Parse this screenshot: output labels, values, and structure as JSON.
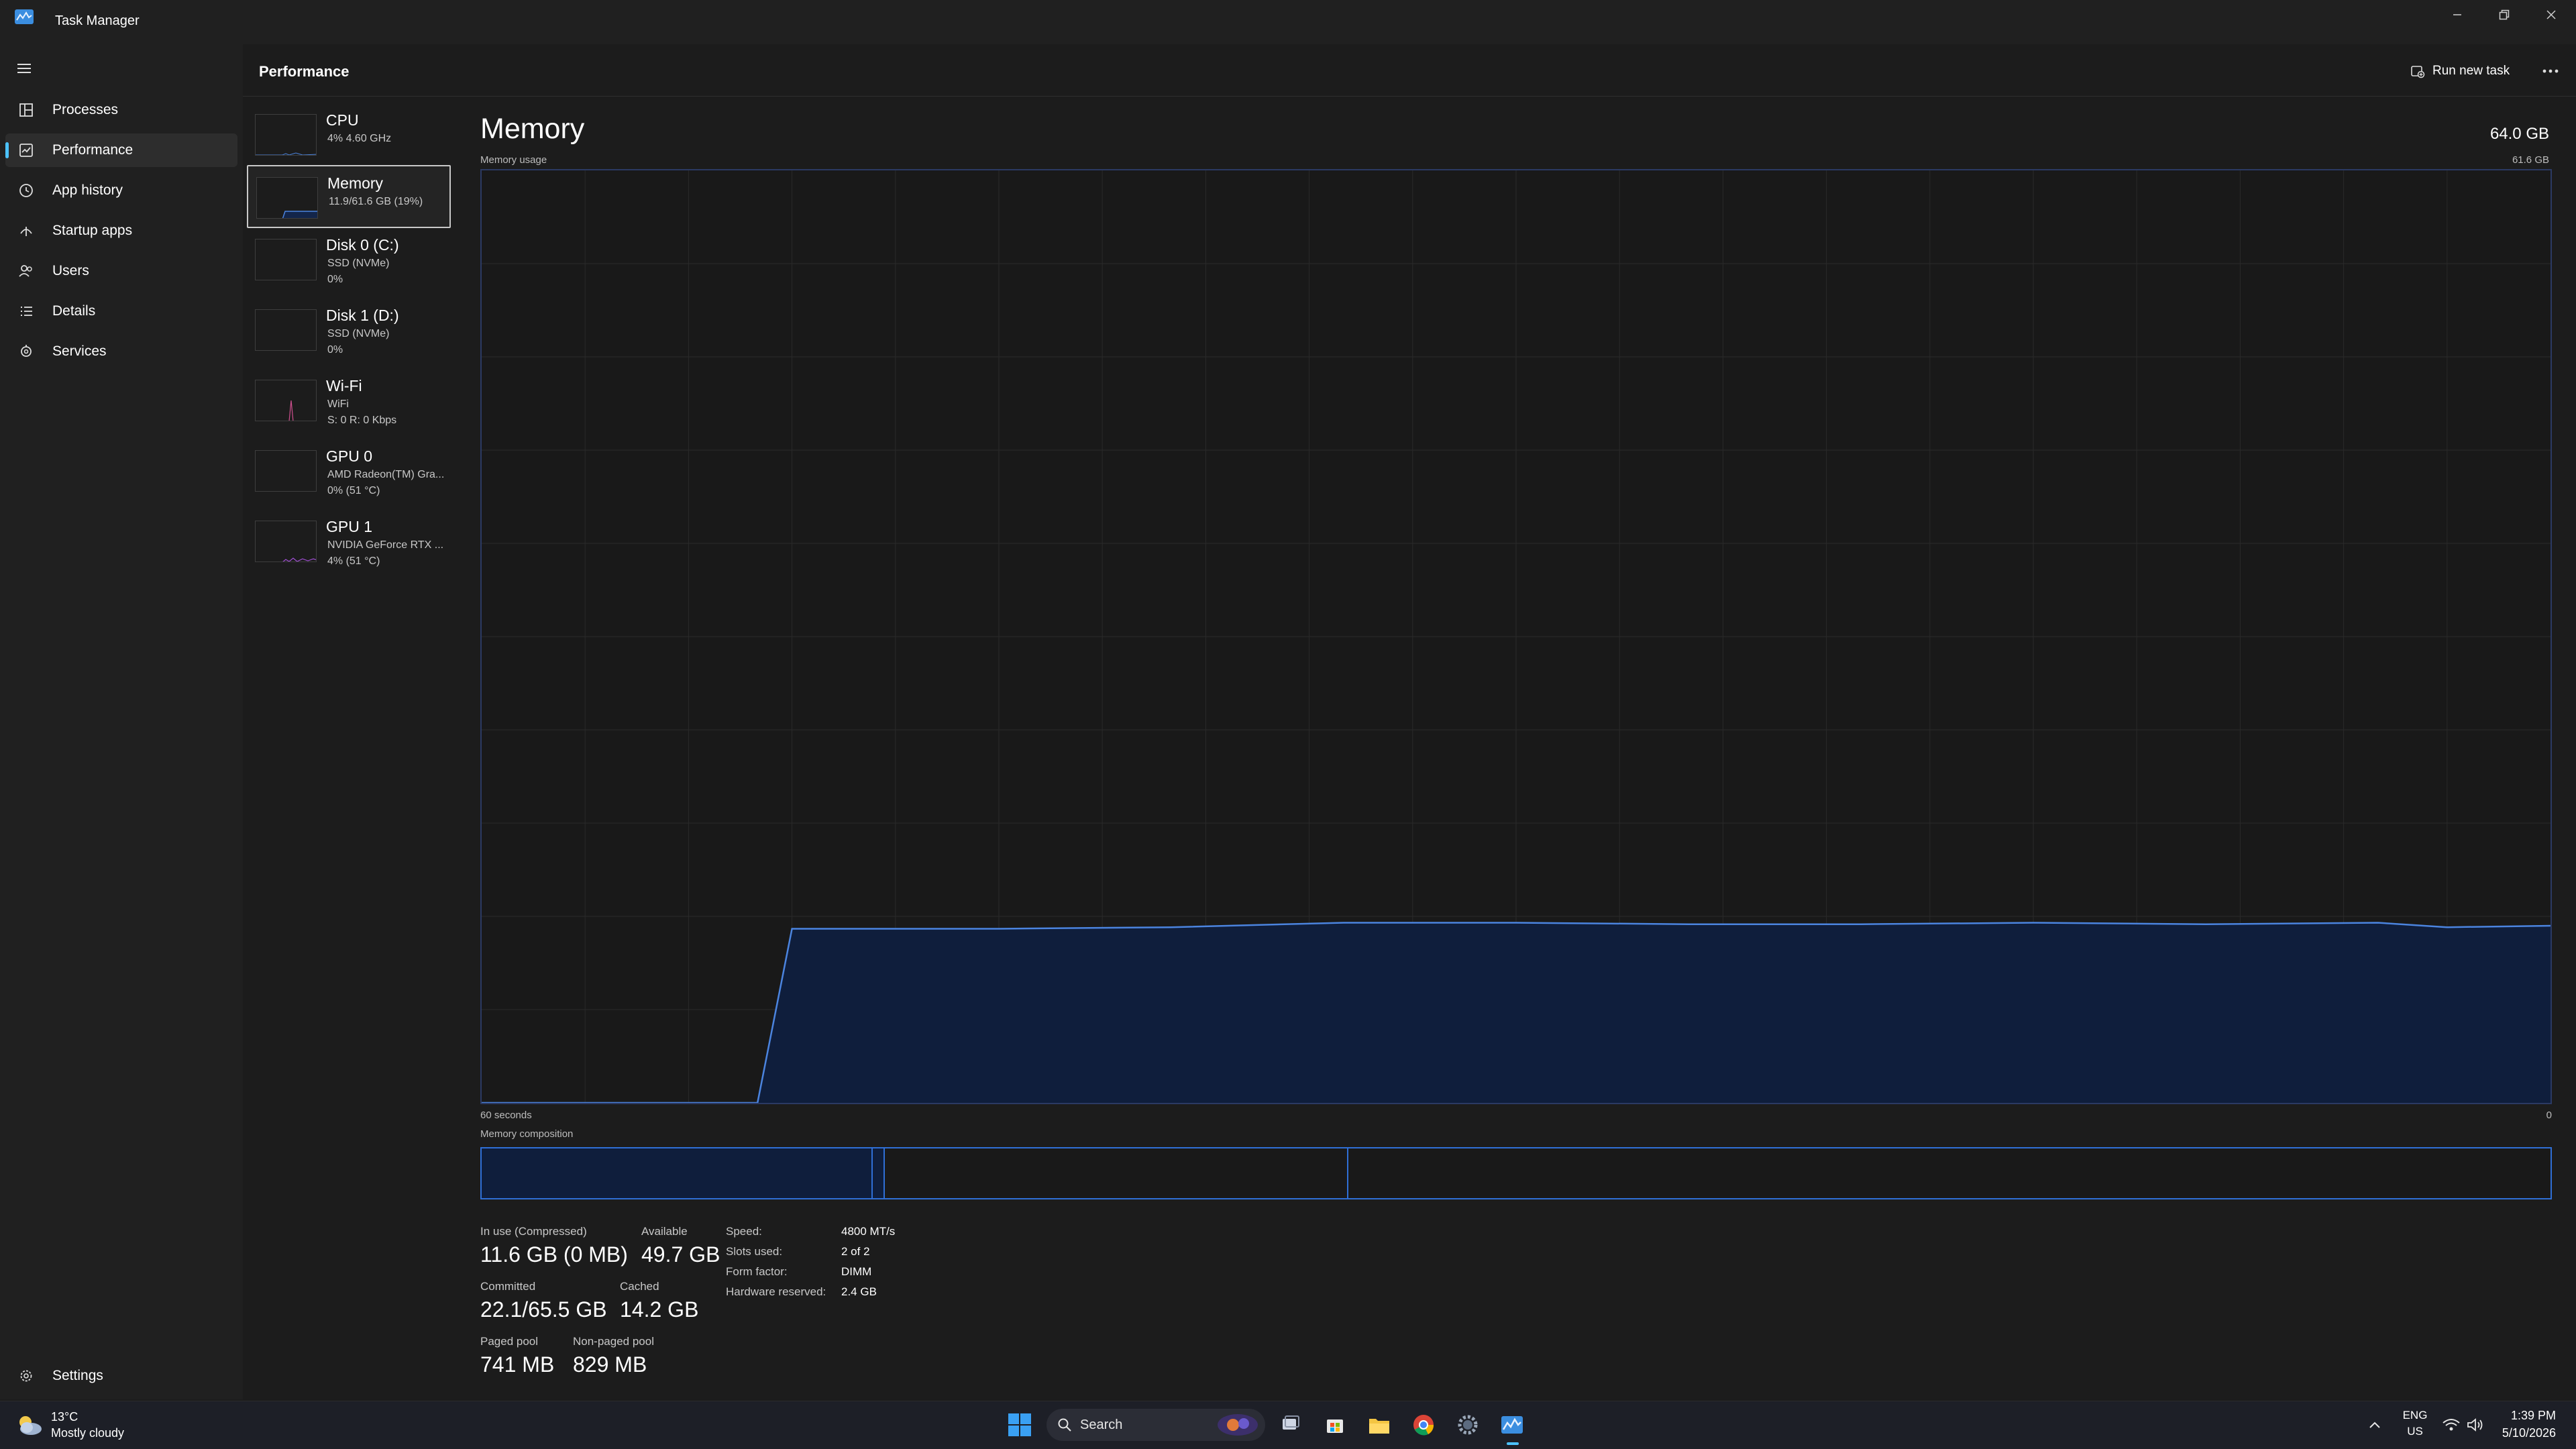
{
  "window": {
    "title": "Task Manager"
  },
  "nav": {
    "items": [
      {
        "label": "Processes",
        "icon": "processes-icon"
      },
      {
        "label": "Performance",
        "icon": "performance-icon",
        "active": true
      },
      {
        "label": "App history",
        "icon": "history-icon"
      },
      {
        "label": "Startup apps",
        "icon": "startup-icon"
      },
      {
        "label": "Users",
        "icon": "users-icon"
      },
      {
        "label": "Details",
        "icon": "details-icon"
      },
      {
        "label": "Services",
        "icon": "services-icon"
      }
    ],
    "settings_label": "Settings"
  },
  "header": {
    "title": "Performance",
    "run_task_label": "Run new task"
  },
  "resources": [
    {
      "name": "CPU",
      "line2": "4% 4.60 GHz",
      "line3": ""
    },
    {
      "name": "Memory",
      "line2": "11.9/61.6 GB (19%)",
      "line3": "",
      "selected": true
    },
    {
      "name": "Disk 0 (C:)",
      "line2": "SSD (NVMe)",
      "line3": "0%"
    },
    {
      "name": "Disk 1 (D:)",
      "line2": "SSD (NVMe)",
      "line3": "0%"
    },
    {
      "name": "Wi-Fi",
      "line2": "WiFi",
      "line3": "S: 0 R: 0 Kbps"
    },
    {
      "name": "GPU 0",
      "line2": "AMD Radeon(TM) Gra...",
      "line3": "0% (51 °C)"
    },
    {
      "name": "GPU 1",
      "line2": "NVIDIA GeForce RTX ...",
      "line3": "4% (51 °C)"
    }
  ],
  "main": {
    "title": "Memory",
    "total": "64.0 GB",
    "usage_label": "Memory usage",
    "usage_max": "61.6 GB",
    "axis_left": "60 seconds",
    "axis_right": "0",
    "composition_label": "Memory composition"
  },
  "chart_data": {
    "type": "area",
    "title": "Memory usage",
    "x": [
      0,
      8,
      9,
      11,
      15,
      20,
      25,
      30,
      35,
      40,
      45,
      50,
      55,
      57,
      60
    ],
    "y": [
      0,
      0,
      11.5,
      11.5,
      11.5,
      11.6,
      11.9,
      11.9,
      11.8,
      11.8,
      11.9,
      11.8,
      11.9,
      11.6,
      11.7
    ],
    "xlim": [
      60,
      0
    ],
    "ylim": [
      0,
      61.6
    ],
    "xlabel": "60 seconds",
    "grid": true,
    "colors": {
      "line": "#4b84df",
      "fill": "#0f1e3c",
      "grid": "#2a2a2a",
      "border": "#2b3a63"
    }
  },
  "composition": {
    "in_use_fraction": 0.189,
    "modified_fraction": 0.006,
    "standby_fraction": 0.224
  },
  "stats": {
    "in_use": {
      "label": "In use (Compressed)",
      "value": "11.6 GB (0 MB)"
    },
    "available": {
      "label": "Available",
      "value": "49.7 GB"
    },
    "committed": {
      "label": "Committed",
      "value": "22.1/65.5 GB"
    },
    "cached": {
      "label": "Cached",
      "value": "14.2 GB"
    },
    "paged_pool": {
      "label": "Paged pool",
      "value": "741 MB"
    },
    "nonpaged_pool": {
      "label": "Non-paged pool",
      "value": "829 MB"
    }
  },
  "specs": [
    {
      "label": "Speed:",
      "value": "4800 MT/s"
    },
    {
      "label": "Slots used:",
      "value": "2 of 2"
    },
    {
      "label": "Form factor:",
      "value": "DIMM"
    },
    {
      "label": "Hardware reserved:",
      "value": "2.4 GB"
    }
  ],
  "taskbar": {
    "weather_temp": "13°C",
    "weather_desc": "Mostly cloudy",
    "search_placeholder": "Search",
    "lang_line1": "ENG",
    "lang_line2": "US",
    "time": "1:39 PM",
    "date": "5/10/2026"
  }
}
